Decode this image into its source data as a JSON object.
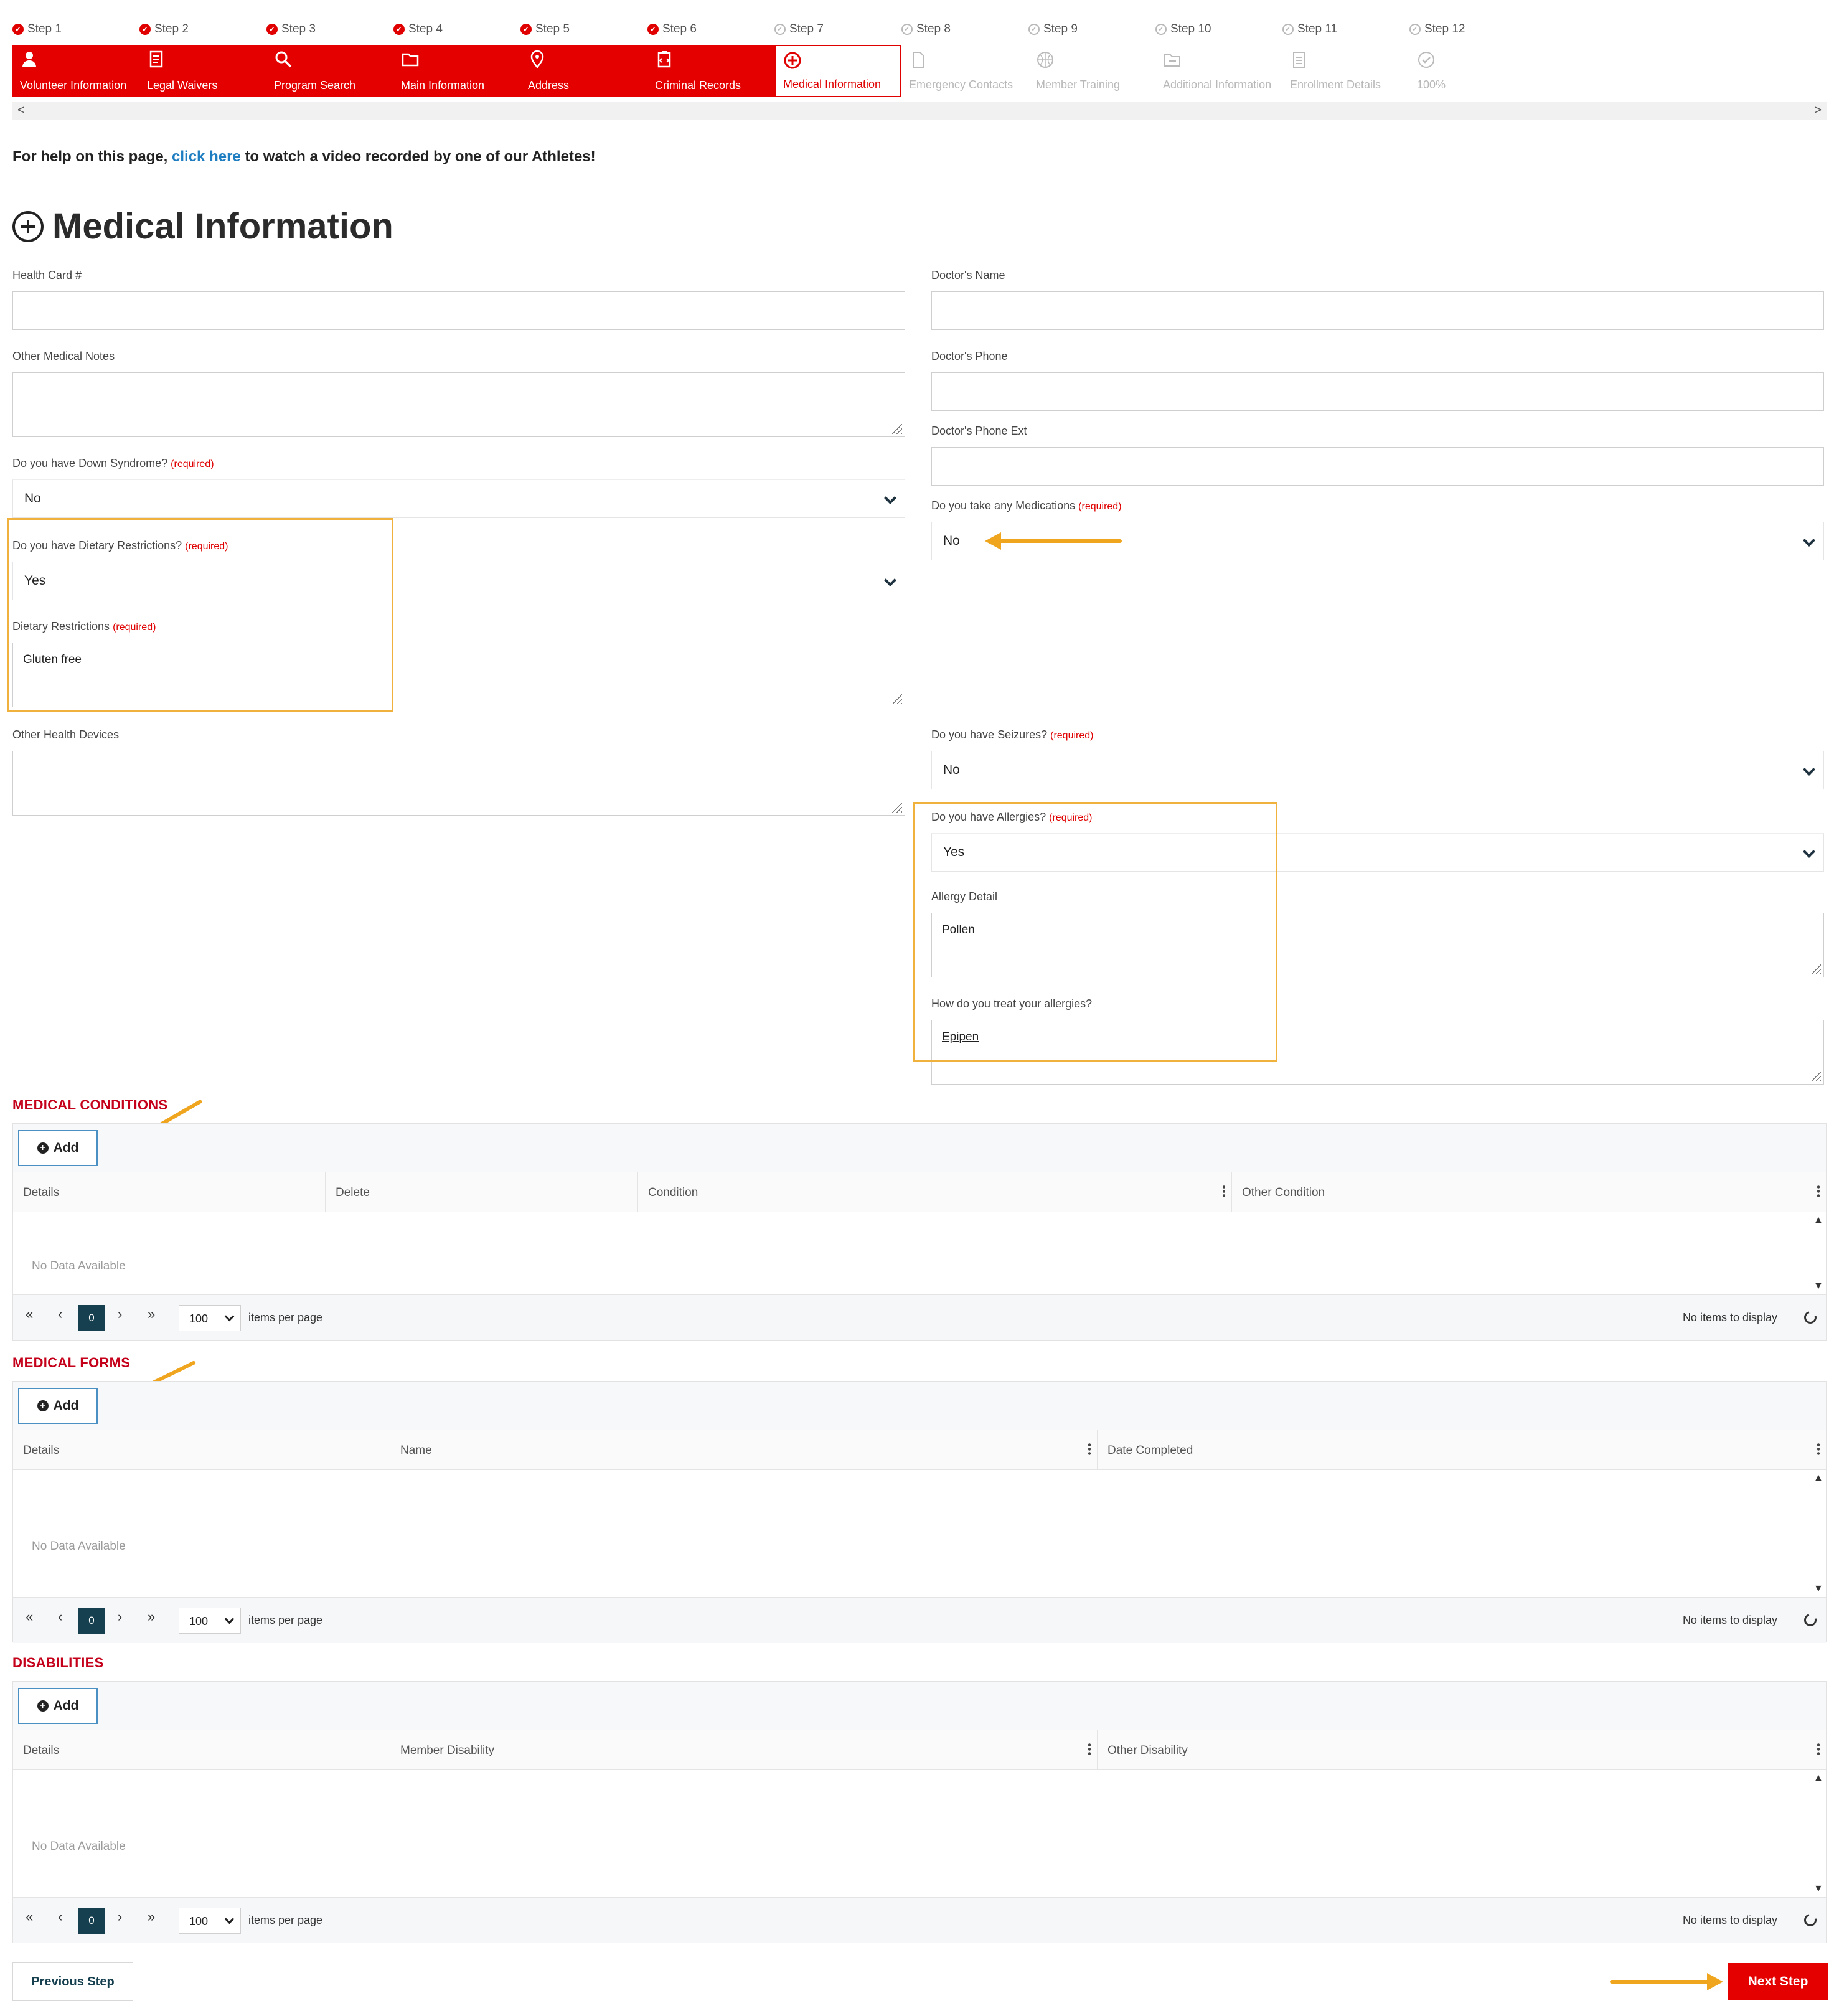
{
  "wizard": {
    "steps": [
      {
        "step": "Step 1",
        "label": "Volunteer Information",
        "status": "done",
        "icon": "person-icon"
      },
      {
        "step": "Step 2",
        "label": "Legal Waivers",
        "status": "done",
        "icon": "document-icon"
      },
      {
        "step": "Step 3",
        "label": "Program Search",
        "status": "done",
        "icon": "search-icon"
      },
      {
        "step": "Step 4",
        "label": "Main Information",
        "status": "done",
        "icon": "folder-icon"
      },
      {
        "step": "Step 5",
        "label": "Address",
        "status": "done",
        "icon": "location-pin-icon"
      },
      {
        "step": "Step 6",
        "label": "Criminal Records",
        "status": "done",
        "icon": "clipboard-icon"
      },
      {
        "step": "Step 7",
        "label": "Medical Information",
        "status": "current",
        "icon": "plus-circle-icon"
      },
      {
        "step": "Step 8",
        "label": "Emergency Contacts",
        "status": "todo",
        "icon": "file-icon"
      },
      {
        "step": "Step 9",
        "label": "Member Training",
        "status": "todo",
        "icon": "ball-icon"
      },
      {
        "step": "Step 10",
        "label": "Additional Information",
        "status": "todo",
        "icon": "folder-list-icon"
      },
      {
        "step": "Step 11",
        "label": "Enrollment Details",
        "status": "todo",
        "icon": "document-lines-icon"
      },
      {
        "step": "Step 12",
        "label": "100%",
        "status": "todo",
        "icon": "check-circle-icon"
      }
    ],
    "scroll_left": "<",
    "scroll_right": ">"
  },
  "help": {
    "prefix": "For help on this page, ",
    "link": "click here",
    "suffix": " to watch a video recorded by one of our Athletes!"
  },
  "page_title": "Medical Information",
  "required_tag": "(required)",
  "form": {
    "health_card": {
      "label": "Health Card #",
      "value": ""
    },
    "other_medical_notes": {
      "label": "Other Medical Notes",
      "value": ""
    },
    "down_syndrome": {
      "label": "Do you have Down Syndrome?",
      "value": "No"
    },
    "dietary_restrictions_q": {
      "label": "Do you have Dietary Restrictions?",
      "value": "Yes"
    },
    "dietary_restrictions": {
      "label": "Dietary Restrictions",
      "value": "Gluten free"
    },
    "other_health_devices": {
      "label": "Other Health Devices",
      "value": ""
    },
    "doctor_name": {
      "label": "Doctor's Name",
      "value": ""
    },
    "doctor_phone": {
      "label": "Doctor's Phone",
      "value": ""
    },
    "doctor_phone_ext": {
      "label": "Doctor's Phone Ext",
      "value": ""
    },
    "medications": {
      "label": "Do you take any Medications",
      "value": "No"
    },
    "seizures": {
      "label": "Do you have Seizures?",
      "value": "No"
    },
    "allergies": {
      "label": "Do you have Allergies?",
      "value": "Yes"
    },
    "allergy_detail": {
      "label": "Allergy Detail",
      "value": "Pollen"
    },
    "allergy_treatment": {
      "label": "How do you treat your allergies?",
      "value": "Epipen"
    }
  },
  "grid_common": {
    "add_label": "Add",
    "no_data": "No Data Available",
    "page_number": "0",
    "per_page": "100",
    "items_per_page": "items per page",
    "no_items": "No items to display",
    "first": "«",
    "prev": "‹",
    "next": "›",
    "last": "»"
  },
  "medical_conditions": {
    "title": "MEDICAL CONDITIONS",
    "columns": [
      "Details",
      "Delete",
      "Condition",
      "Other Condition"
    ]
  },
  "medical_forms": {
    "title": "MEDICAL FORMS",
    "columns": [
      "Details",
      "Name",
      "Date Completed"
    ]
  },
  "disabilities": {
    "title": "DISABILITIES",
    "columns": [
      "Details",
      "Member Disability",
      "Other Disability"
    ]
  },
  "buttons": {
    "previous": "Previous Step",
    "next": "Next Step"
  },
  "colors": {
    "brand_red": "#e50000",
    "highlight": "#f0b23c",
    "arrow": "#f0a51f",
    "link": "#1f7ec1"
  }
}
